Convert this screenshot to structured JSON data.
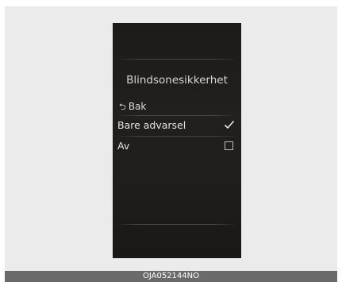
{
  "screen": {
    "title": "Blindsonesikkerhet",
    "back_icon": "back-arrow-icon",
    "back_label": "Bak",
    "items": [
      {
        "label": "Bare advarsel",
        "checked": true
      },
      {
        "label": "Av",
        "checked": false
      }
    ]
  },
  "caption": "OJA052144NO"
}
